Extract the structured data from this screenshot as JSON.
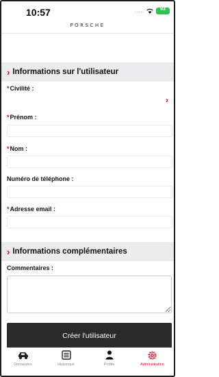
{
  "status_bar": {
    "time": "10:57",
    "signal": ".....",
    "battery": "93"
  },
  "brand": "PORSCHE",
  "section_user": {
    "title": "Informations sur l'utilisateur"
  },
  "fields": {
    "civilite": {
      "label": "Civilité :",
      "required": true,
      "value": ""
    },
    "prenom": {
      "label": "Prénom :",
      "required": true,
      "value": ""
    },
    "nom": {
      "label": "Nom :",
      "required": true,
      "value": ""
    },
    "telephone": {
      "label": "Numéro de téléphone :",
      "required": false,
      "value": ""
    },
    "email": {
      "label": "Adresse email :",
      "required": true,
      "value": ""
    }
  },
  "required_marker": "*",
  "section_extra": {
    "title": "Informations complémentaires"
  },
  "comments": {
    "label": "Commentaires :",
    "value": ""
  },
  "create_button": "Créer l'utilisateur",
  "tabs": [
    {
      "label": "Demandes",
      "icon": "car-icon",
      "active": false
    },
    {
      "label": "Historique",
      "icon": "list-icon",
      "active": false
    },
    {
      "label": "Profile",
      "icon": "user-icon",
      "active": false
    },
    {
      "label": "Administration",
      "icon": "gear-icon",
      "active": true
    }
  ],
  "colors": {
    "accent": "#d5001c",
    "section_background": "#ececef",
    "button_background": "#2b2b2b",
    "battery": "#2fc44f"
  }
}
